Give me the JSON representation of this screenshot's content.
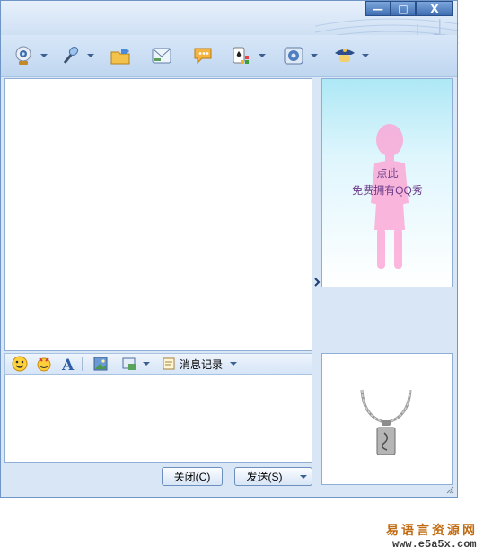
{
  "window": {
    "minimize": "—",
    "maximize": "□",
    "close": "X"
  },
  "toolbar": {
    "items": [
      {
        "icon": "webcam-icon",
        "dropdown": true
      },
      {
        "icon": "microphone-icon",
        "dropdown": true
      },
      {
        "icon": "send-file-icon",
        "dropdown": false
      },
      {
        "icon": "mail-icon",
        "dropdown": false
      },
      {
        "icon": "chat-bubble-icon",
        "dropdown": false
      },
      {
        "icon": "games-icon",
        "dropdown": true
      },
      {
        "icon": "settings-icon",
        "dropdown": true
      },
      {
        "icon": "security-icon",
        "dropdown": true
      }
    ]
  },
  "format_bar": {
    "icons": [
      "emoticon-icon",
      "magic-face-icon",
      "font-icon",
      "image-icon",
      "screenshot-icon"
    ],
    "history_label": "消息记录"
  },
  "buttons": {
    "close": "关闭(C)",
    "send": "发送(S)"
  },
  "qq_show": {
    "line1": "点此",
    "line2": "免费拥有QQ秀"
  },
  "watermark": {
    "name": "易语言资源网",
    "url": "www.e5a5x.com"
  }
}
